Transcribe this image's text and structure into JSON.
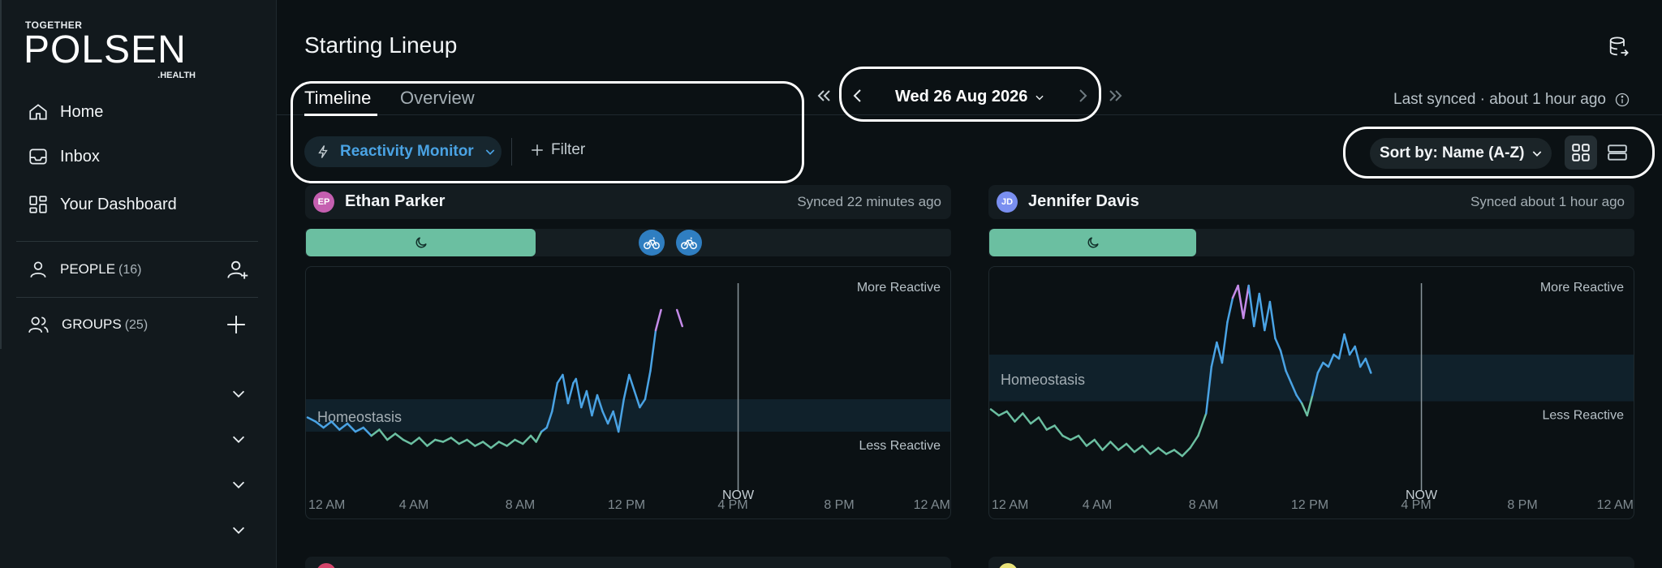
{
  "brand": {
    "top": "TOGETHER",
    "name": "POLSEN",
    "suffix": ".HEALTH"
  },
  "nav": [
    {
      "label": "Home",
      "icon": "home-icon"
    },
    {
      "label": "Inbox",
      "icon": "inbox-icon"
    },
    {
      "label": "Your Dashboard",
      "icon": "dashboard-icon"
    }
  ],
  "sections": {
    "people": {
      "label": "PEOPLE",
      "count": "(16)"
    },
    "groups": {
      "label": "GROUPS",
      "count": "(25)"
    }
  },
  "page": {
    "title": "Starting Lineup"
  },
  "tabs": [
    {
      "label": "Timeline",
      "active": true
    },
    {
      "label": "Overview",
      "active": false
    }
  ],
  "monitor": {
    "label": "Reactivity Monitor"
  },
  "filter": {
    "label": "Filter"
  },
  "date": {
    "label": "Wed 26 Aug 2026"
  },
  "sync": {
    "label": "Last synced · about 1 hour ago"
  },
  "sort": {
    "label": "Sort by: Name (A-Z)"
  },
  "colors": {
    "accent": "#4aa3e4",
    "calm": "#6bbfa1",
    "reactive": "#c58be9",
    "band": "#10212b",
    "bg": "#0b1114"
  },
  "chart_labels": {
    "more": "More Reactive",
    "less": "Less Reactive",
    "homeostasis": "Homeostasis",
    "now": "NOW",
    "ticks": [
      "12 AM",
      "4 AM",
      "8 AM",
      "12 PM",
      "4 PM",
      "8 PM",
      "12 AM"
    ]
  },
  "cards": [
    {
      "initials": "EP",
      "name": "Ethan Parker",
      "synced": "Synced 22 minutes ago",
      "avatar_color": "#c55fb0"
    },
    {
      "initials": "JD",
      "name": "Jennifer Davis",
      "synced": "Synced about 1 hour ago",
      "avatar_color": "#7a8ff0"
    }
  ],
  "chart_data": [
    {
      "type": "line",
      "title": "Ethan Parker",
      "x_unit": "hours since 12 AM",
      "xlim": [
        0,
        24
      ],
      "ylim": [
        0,
        100
      ],
      "now_hour": 16.2,
      "homeostasis_band": [
        26,
        42
      ],
      "series": [
        {
          "points": [
            [
              0,
              33
            ],
            [
              0.3,
              31
            ],
            [
              0.6,
              28
            ],
            [
              0.9,
              31
            ],
            [
              1.2,
              27
            ],
            [
              1.5,
              30
            ],
            [
              1.8,
              26
            ],
            [
              2.1,
              28
            ],
            [
              2.4,
              24
            ],
            [
              2.7,
              27
            ],
            [
              3.0,
              22
            ],
            [
              3.3,
              25
            ],
            [
              3.6,
              22
            ],
            [
              3.9,
              20
            ],
            [
              4.2,
              23
            ],
            [
              4.5,
              19
            ],
            [
              4.8,
              22
            ],
            [
              5.1,
              21
            ],
            [
              5.4,
              23
            ],
            [
              5.7,
              20
            ],
            [
              6.0,
              22
            ],
            [
              6.3,
              19
            ],
            [
              6.6,
              21
            ],
            [
              6.9,
              18
            ],
            [
              7.2,
              21
            ],
            [
              7.5,
              19
            ],
            [
              7.8,
              22
            ],
            [
              8.1,
              20
            ],
            [
              8.4,
              24
            ],
            [
              8.6,
              21
            ],
            [
              8.8,
              26
            ],
            [
              9.0,
              28
            ],
            [
              9.2,
              36
            ],
            [
              9.4,
              50
            ],
            [
              9.6,
              54
            ],
            [
              9.8,
              40
            ],
            [
              10.0,
              50
            ],
            [
              10.1,
              52
            ],
            [
              10.3,
              38
            ],
            [
              10.5,
              46
            ],
            [
              10.7,
              34
            ],
            [
              10.9,
              44
            ],
            [
              11.1,
              36
            ],
            [
              11.3,
              30
            ],
            [
              11.5,
              36
            ],
            [
              11.7,
              26
            ],
            [
              11.9,
              42
            ],
            [
              12.1,
              54
            ],
            [
              12.3,
              46
            ],
            [
              12.5,
              38
            ],
            [
              12.7,
              42
            ],
            [
              12.9,
              56
            ],
            [
              13.1,
              76
            ],
            [
              13.3,
              86
            ]
          ]
        },
        {
          "points": [
            [
              13.9,
              86
            ],
            [
              14.1,
              78
            ]
          ]
        }
      ]
    },
    {
      "type": "line",
      "title": "Jennifer Davis",
      "x_unit": "hours since 12 AM",
      "xlim": [
        0,
        24
      ],
      "ylim": [
        0,
        100
      ],
      "now_hour": 16.2,
      "homeostasis_band": [
        41,
        64
      ],
      "series": [
        {
          "points": [
            [
              0,
              37
            ],
            [
              0.3,
              34
            ],
            [
              0.6,
              36
            ],
            [
              0.9,
              31
            ],
            [
              1.2,
              35
            ],
            [
              1.5,
              30
            ],
            [
              1.8,
              33
            ],
            [
              2.1,
              27
            ],
            [
              2.4,
              29
            ],
            [
              2.7,
              24
            ],
            [
              3.0,
              22
            ],
            [
              3.3,
              24
            ],
            [
              3.6,
              19
            ],
            [
              3.9,
              22
            ],
            [
              4.2,
              17
            ],
            [
              4.5,
              21
            ],
            [
              4.8,
              17
            ],
            [
              5.1,
              20
            ],
            [
              5.4,
              16
            ],
            [
              5.7,
              19
            ],
            [
              6.0,
              15
            ],
            [
              6.3,
              18
            ],
            [
              6.6,
              15
            ],
            [
              6.9,
              17
            ],
            [
              7.2,
              14
            ],
            [
              7.5,
              18
            ],
            [
              7.8,
              24
            ],
            [
              8.1,
              35
            ],
            [
              8.3,
              58
            ],
            [
              8.5,
              70
            ],
            [
              8.7,
              60
            ],
            [
              8.9,
              80
            ],
            [
              9.1,
              92
            ],
            [
              9.3,
              98
            ],
            [
              9.5,
              82
            ],
            [
              9.7,
              98
            ],
            [
              9.9,
              78
            ],
            [
              10.1,
              94
            ],
            [
              10.3,
              76
            ],
            [
              10.5,
              90
            ],
            [
              10.7,
              72
            ],
            [
              10.9,
              66
            ],
            [
              11.1,
              56
            ],
            [
              11.3,
              50
            ],
            [
              11.5,
              44
            ],
            [
              11.7,
              40
            ],
            [
              11.9,
              34
            ],
            [
              12.1,
              44
            ],
            [
              12.3,
              55
            ],
            [
              12.5,
              60
            ],
            [
              12.7,
              58
            ],
            [
              12.9,
              64
            ],
            [
              13.1,
              62
            ],
            [
              13.3,
              74
            ],
            [
              13.5,
              64
            ],
            [
              13.7,
              68
            ],
            [
              13.9,
              58
            ],
            [
              14.1,
              62
            ],
            [
              14.3,
              55
            ]
          ]
        }
      ]
    }
  ]
}
